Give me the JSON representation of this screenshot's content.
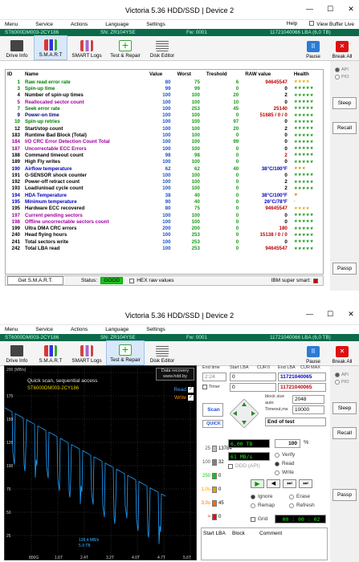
{
  "app_title": "Victoria 5.36 HDD/SSD | Device 2",
  "menu": {
    "items": [
      "Menu",
      "Service",
      "Actions",
      "Language",
      "Settings"
    ],
    "help": "Help",
    "view_buffer": "View Buffer Live"
  },
  "device": {
    "model": "ST6000DM003-2CY186",
    "serial": "SN: ZR104YSE",
    "firmware": "Fw: 0001",
    "lba": "11721040066 LBA (6,0 TB)"
  },
  "toolbar": {
    "drive_info": "Drive Info",
    "smart": "S.M.A.R.T",
    "smart_logs": "SMART Logs",
    "test_repair": "Test & Repair",
    "disk_editor": "Disk Editor",
    "pause": "Pause",
    "break_all": "Break All"
  },
  "side": {
    "api": "API",
    "pio": "PIO",
    "sleep": "Sleep",
    "recall": "Recall",
    "passp": "Passp"
  },
  "smart_headers": [
    "ID",
    "Name",
    "Value",
    "Worst",
    "Treshold",
    "RAW value",
    "Health"
  ],
  "smart_rows": [
    {
      "id": "1",
      "name": "Raw read error rate",
      "value": "80",
      "worst": "75",
      "thr": "6",
      "raw": "94645547",
      "health": "★★★★",
      "color": "#008000",
      "rawcolor": "#c00000"
    },
    {
      "id": "3",
      "name": "Spin-up time",
      "value": "99",
      "worst": "99",
      "thr": "0",
      "raw": "0",
      "health": "★★★★★",
      "color": "#008000",
      "rawcolor": "#000"
    },
    {
      "id": "4",
      "name": "Number of spin-up times",
      "value": "100",
      "worst": "100",
      "thr": "20",
      "raw": "2",
      "health": "★★★★★",
      "color": "#000",
      "rawcolor": "#000"
    },
    {
      "id": "5",
      "name": "Reallocated sector count",
      "value": "100",
      "worst": "100",
      "thr": "10",
      "raw": "0",
      "health": "★★★★★",
      "color": "#a000a0",
      "rawcolor": "#000"
    },
    {
      "id": "7",
      "name": "Seek error rate",
      "value": "100",
      "worst": "253",
      "thr": "45",
      "raw": "25140",
      "health": "★★★★★",
      "color": "#008000",
      "rawcolor": "#c00000"
    },
    {
      "id": "9",
      "name": "Power-on time",
      "value": "100",
      "worst": "100",
      "thr": "0",
      "raw": "51685 / 0 / 0",
      "health": "★★★★★",
      "color": "#000080",
      "rawcolor": "#c00000"
    },
    {
      "id": "10",
      "name": "Spin-up retries",
      "value": "100",
      "worst": "100",
      "thr": "97",
      "raw": "0",
      "health": "★★★★★",
      "color": "#008000",
      "rawcolor": "#000"
    },
    {
      "id": "12",
      "name": "Start/stop count",
      "value": "100",
      "worst": "100",
      "thr": "20",
      "raw": "2",
      "health": "★★★★★",
      "color": "#000",
      "rawcolor": "#000"
    },
    {
      "id": "183",
      "name": "Runtime Bad Block (Total)",
      "value": "100",
      "worst": "100",
      "thr": "0",
      "raw": "0",
      "health": "★★★★★",
      "color": "#000",
      "rawcolor": "#000"
    },
    {
      "id": "184",
      "name": "I/O CRC Error Detection Count Total",
      "value": "100",
      "worst": "100",
      "thr": "99",
      "raw": "0",
      "health": "★★★★★",
      "color": "#a000a0",
      "rawcolor": "#000"
    },
    {
      "id": "187",
      "name": "Uncorrectable ECC Errors",
      "value": "100",
      "worst": "100",
      "thr": "0",
      "raw": "0",
      "health": "★★★★★",
      "color": "#a000a0",
      "rawcolor": "#000"
    },
    {
      "id": "188",
      "name": "Command timeout count",
      "value": "98",
      "worst": "98",
      "thr": "0",
      "raw": "2",
      "health": "★★★★★",
      "color": "#000",
      "rawcolor": "#c00000"
    },
    {
      "id": "189",
      "name": "High Fly writes",
      "value": "100",
      "worst": "100",
      "thr": "0",
      "raw": "0",
      "health": "★★★★★",
      "color": "#000",
      "rawcolor": "#000"
    },
    {
      "id": "190",
      "name": "Airflow temperature",
      "value": "62",
      "worst": "62",
      "thr": "40",
      "raw": "38°C/100°F",
      "health": "★★★",
      "color": "#0000c0",
      "rawcolor": "#0000c0"
    },
    {
      "id": "191",
      "name": "G-SENSOR shock counter",
      "value": "100",
      "worst": "100",
      "thr": "0",
      "raw": "0",
      "health": "★★★★★",
      "color": "#000",
      "rawcolor": "#000"
    },
    {
      "id": "192",
      "name": "Power-off retract count",
      "value": "100",
      "worst": "100",
      "thr": "0",
      "raw": "2",
      "health": "★★★★★",
      "color": "#000",
      "rawcolor": "#000"
    },
    {
      "id": "193",
      "name": "Load/unload cycle count",
      "value": "100",
      "worst": "100",
      "thr": "0",
      "raw": "2",
      "health": "★★★★★",
      "color": "#000",
      "rawcolor": "#000"
    },
    {
      "id": "194",
      "name": "HDA Temperature",
      "value": "38",
      "worst": "40",
      "thr": "0",
      "raw": "38°C/100°F",
      "health": "★",
      "color": "#0000c0",
      "rawcolor": "#0000c0"
    },
    {
      "id": "195",
      "name": "Minimum temperature",
      "value": "90",
      "worst": "40",
      "thr": "0",
      "raw": "26°C/78°F",
      "health": "-",
      "color": "#0000c0",
      "rawcolor": "#0000c0"
    },
    {
      "id": "195",
      "name": "Hardware ECC recovered",
      "value": "80",
      "worst": "75",
      "thr": "0",
      "raw": "94645547",
      "health": "★★★★",
      "color": "#000",
      "rawcolor": "#c00000"
    },
    {
      "id": "197",
      "name": "Current pending sectors",
      "value": "100",
      "worst": "100",
      "thr": "0",
      "raw": "0",
      "health": "★★★★★",
      "color": "#a000a0",
      "rawcolor": "#000"
    },
    {
      "id": "198",
      "name": "Offline uncorrectable sectors count",
      "value": "100",
      "worst": "100",
      "thr": "0",
      "raw": "0",
      "health": "★★★★★",
      "color": "#a000a0",
      "rawcolor": "#000"
    },
    {
      "id": "199",
      "name": "Ultra DMA CRC errors",
      "value": "200",
      "worst": "200",
      "thr": "0",
      "raw": "180",
      "health": "★★★★★",
      "color": "#000",
      "rawcolor": "#c00000"
    },
    {
      "id": "240",
      "name": "Head flying hours",
      "value": "100",
      "worst": "253",
      "thr": "0",
      "raw": "15138 / 0 / 0",
      "health": "★★★★★",
      "color": "#000",
      "rawcolor": "#c00000"
    },
    {
      "id": "241",
      "name": "Total sectors write",
      "value": "100",
      "worst": "253",
      "thr": "0",
      "raw": "0",
      "health": "★★★★★",
      "color": "#000",
      "rawcolor": "#000"
    },
    {
      "id": "242",
      "name": "Total LBA read",
      "value": "100",
      "worst": "253",
      "thr": "0",
      "raw": "94645547",
      "health": "★★★★★",
      "color": "#000",
      "rawcolor": "#c00000"
    }
  ],
  "status_bar": {
    "get_smart": "Get S.M.A.R.T.",
    "status_label": "Status:",
    "status_value": "GOOD",
    "hex_raw": "HEX raw values",
    "ibm_smart": "IBM super smart:"
  },
  "graph": {
    "header": "200 (MB/s)",
    "title": "Quick scan, sequential access",
    "model": "ST6000DM003-2CY186",
    "recovery1": "Data recovery",
    "recovery2": "www.hdd.by",
    "read": "Read",
    "write": "Write",
    "speed1": "139,4 MB/s",
    "speed2": "5.9 TB",
    "yticks": [
      "175",
      "150",
      "125",
      "100",
      "75",
      "50",
      "25"
    ],
    "xticks": [
      "800G",
      "1.6T",
      "2.4T",
      "3.2T",
      "4.0T",
      "4.7T",
      "5.6T"
    ]
  },
  "test": {
    "end_time_lbl": "End time",
    "start_lba_lbl": "Start LBA",
    "cur": "CUR",
    "cur_val": "0",
    "end_lba_lbl": "End LBA",
    "max": "MAX",
    "time": "2:24",
    "start_lba": "0",
    "end_lba": "11721040065",
    "timer_lbl": "Timer",
    "timer_val": "0",
    "end_lba2": "11721040065",
    "block_size_lbl": "block size",
    "auto": "auto",
    "block_size": "2048",
    "timeout_lbl": "Timeout,ms",
    "timeout": "10000",
    "scan": "Scan",
    "quick": "QUICK",
    "end_of_test": "End of test",
    "size": "6,00 TB",
    "percent": "100",
    "percent_unit": "%",
    "speed": "61 MB/s",
    "verify": "Verify",
    "read": "Read",
    "write": "Write",
    "ddd": "DDD (API)",
    "ignore": "Ignore",
    "erase": "Erase",
    "remap": "Remap",
    "refresh": "Refresh",
    "grid": "Grid",
    "clock": "00 : 00 : 02"
  },
  "blocks": [
    {
      "ms": "25",
      "count": "13784",
      "color": "#bfbfbf"
    },
    {
      "ms": "100",
      "count": "32",
      "color": "#808080"
    },
    {
      "ms": "250",
      "count": "0",
      "color": "#19c219"
    },
    {
      "ms": "1,0s",
      "count": "0",
      "color": "#ff9900"
    },
    {
      "ms": "3,0s",
      "count": "45",
      "color": "#ff6a00"
    },
    {
      "ms": ">",
      "count": "0",
      "color": "#ff0000"
    },
    {
      "ms": "Err",
      "count": "0",
      "color": "#0000ff"
    }
  ],
  "log_headers": {
    "start_lba": "Start LBA",
    "block": "Block",
    "comment": "Comment"
  }
}
